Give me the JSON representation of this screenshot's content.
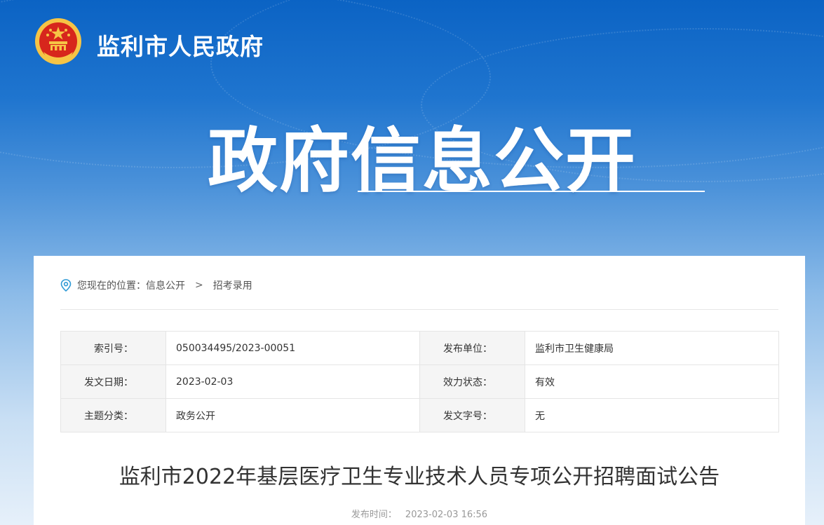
{
  "header": {
    "site_title": "监利市人民政府",
    "banner_title": "政府信息公开"
  },
  "breadcrumb": {
    "prefix": "您现在的位置：",
    "items": [
      "信息公开",
      "招考录用"
    ],
    "separator": ">"
  },
  "meta": {
    "rows": [
      {
        "k1": "索引号：",
        "v1": "050034495/2023-00051",
        "k2": "发布单位：",
        "v2": "监利市卫生健康局"
      },
      {
        "k1": "发文日期：",
        "v1": "2023-02-03",
        "k2": "效力状态：",
        "v2": "有效"
      },
      {
        "k1": "主题分类：",
        "v1": "政务公开",
        "k2": "发文字号：",
        "v2": "无"
      }
    ]
  },
  "article": {
    "title": "监利市2022年基层医疗卫生专业技术人员专项公开招聘面试公告",
    "pub_label": "发布时间：",
    "pub_time": "2023-02-03 16:56"
  },
  "colors": {
    "banner_top": "#0b63c4",
    "emblem_red": "#d7261c",
    "emblem_gold": "#f6c445",
    "location_icon": "#2f9ad6"
  },
  "icons": {
    "emblem": "national-emblem-icon",
    "location": "location-pin-icon"
  }
}
